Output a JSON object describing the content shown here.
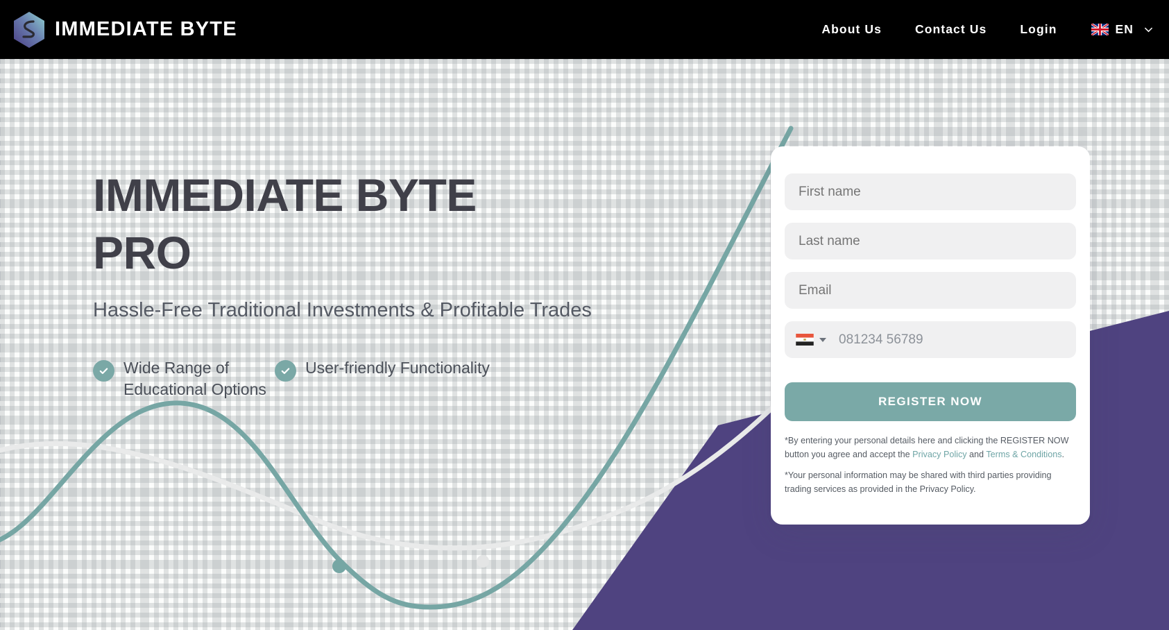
{
  "header": {
    "brand_name": "IMMEDIATE BYTE",
    "brand_icon": "hexagon-logo-icon",
    "nav": [
      {
        "label": "About Us",
        "name": "nav-about-us"
      },
      {
        "label": "Contact Us",
        "name": "nav-contact-us"
      },
      {
        "label": "Login",
        "name": "nav-login"
      }
    ],
    "language": {
      "code": "EN",
      "flag_icon": "uk-flag-icon",
      "chevron_icon": "chevron-down-icon"
    }
  },
  "hero": {
    "title_line_1": "IMMEDIATE BYTE",
    "title_line_2": "PRO",
    "subtitle": "Hassle-Free Traditional Investments & Profitable Trades",
    "features": [
      {
        "label": "Wide Range of Educational Options",
        "icon": "check-circle-icon"
      },
      {
        "label": "User-friendly Functionality",
        "icon": "check-circle-icon"
      }
    ]
  },
  "form": {
    "fields": [
      {
        "name": "first-name-input",
        "placeholder": "First name",
        "value": ""
      },
      {
        "name": "last-name-input",
        "placeholder": "Last name",
        "value": ""
      },
      {
        "name": "email-input",
        "placeholder": "Email",
        "value": ""
      }
    ],
    "phone": {
      "placeholder": "081234 56789",
      "value": "",
      "country_flag_icon": "egypt-flag-icon",
      "dropdown_icon": "caret-down-icon"
    },
    "submit_label": "REGISTER NOW",
    "disclaimer_1_part_1": "*By entering your personal details here and clicking the REGISTER NOW button you agree and accept the ",
    "disclaimer_1_link_1": "Privacy Policy",
    "disclaimer_1_mid": " and ",
    "disclaimer_1_link_2": "Terms & Conditions",
    "disclaimer_1_end": ".",
    "disclaimer_2": "*Your personal information may be shared with third parties providing trading services as provided in the Privacy Policy."
  },
  "colors": {
    "header_bg": "#000000",
    "accent_teal": "#7aa9a7",
    "accent_purple": "#4f4380",
    "heading": "#404049",
    "field_bg": "#f0f0f1",
    "page_bg": "#fbfcfb"
  },
  "decor": {
    "teal_curve": "teal-trend-curve",
    "gray_curve": "gray-trend-curve",
    "purple_polygon": "purple-angled-shape",
    "grid": "dashed-grid-background"
  }
}
